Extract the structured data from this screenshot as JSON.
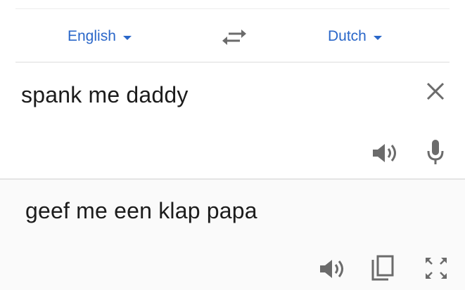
{
  "languages": {
    "source": "English",
    "target": "Dutch"
  },
  "input": {
    "text": "spank me daddy"
  },
  "output": {
    "text": "geef me een klap papa"
  },
  "icons": {
    "swap": "swap-arrows-icon",
    "clear": "close-icon",
    "listen_source": "speaker-icon",
    "voice_input": "microphone-icon",
    "listen_translation": "speaker-icon",
    "copy": "copy-icon",
    "fullscreen": "fullscreen-icon"
  },
  "colors": {
    "accent": "#2a67c9",
    "icon": "#6b6b6b",
    "text": "#1c1c1c"
  }
}
